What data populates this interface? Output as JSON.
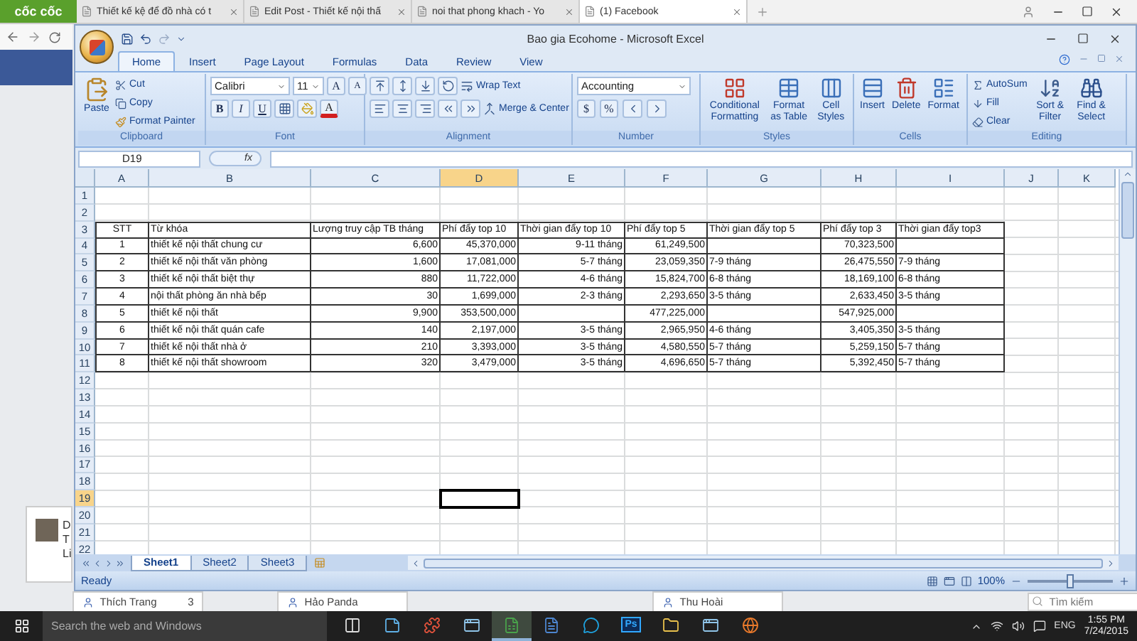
{
  "browser": {
    "logo": "cốc cốc",
    "tabs": [
      {
        "title": "Thiết kế kệ để đồ nhà có t",
        "selected": false
      },
      {
        "title": "Edit Post - Thiết kế nội thấ",
        "selected": false
      },
      {
        "title": "noi that phong khach - Yo",
        "selected": false
      },
      {
        "title": "(1) Facebook",
        "selected": true
      }
    ]
  },
  "page": {
    "notification_lines": [
      "D",
      "T",
      "Li"
    ],
    "chat_tabs": [
      {
        "name": "Thích Trang",
        "count": "3"
      },
      {
        "name": "Hảo Panda"
      },
      {
        "name": "Thu Hoài"
      }
    ],
    "chat_search": {
      "placeholder": "Tìm kiếm"
    }
  },
  "excel": {
    "title": "Bao gia Ecohome - Microsoft Excel",
    "ribbon_tabs": [
      {
        "label": "Home",
        "selected": true
      },
      {
        "label": "Insert",
        "selected": false
      },
      {
        "label": "Page Layout",
        "selected": false
      },
      {
        "label": "Formulas",
        "selected": false
      },
      {
        "label": "Data",
        "selected": false
      },
      {
        "label": "Review",
        "selected": false
      },
      {
        "label": "View",
        "selected": false
      }
    ],
    "clipboard": {
      "label": "Clipboard",
      "paste": "Paste",
      "cut": "Cut",
      "copy": "Copy",
      "format_painter": "Format Painter"
    },
    "font": {
      "label": "Font",
      "name": "Calibri",
      "size": "11",
      "grow": "A",
      "shrink": "A",
      "bold": "B",
      "italic": "I",
      "underline": "U",
      "font_color_button": "A"
    },
    "alignment": {
      "label": "Alignment",
      "wrap": "Wrap Text",
      "merge": "Merge & Center"
    },
    "number": {
      "label": "Number",
      "format": "Accounting",
      "currency": "$",
      "percent": "%"
    },
    "styles": {
      "label": "Styles",
      "buttons": [
        "Conditional Formatting",
        "Format as Table",
        "Cell Styles"
      ]
    },
    "cells": {
      "label": "Cells",
      "buttons": [
        "Insert",
        "Delete",
        "Format"
      ]
    },
    "editing": {
      "label": "Editing",
      "autosum": "AutoSum",
      "fill": "Fill",
      "clear": "Clear",
      "sort": "Sort & Filter",
      "find": "Find & Select"
    },
    "name_box": "D19",
    "fx": "fx",
    "columns": [
      {
        "label": "A",
        "selected": false
      },
      {
        "label": "B",
        "selected": false
      },
      {
        "label": "C",
        "selected": false
      },
      {
        "label": "D",
        "selected": true
      },
      {
        "label": "E",
        "selected": false
      },
      {
        "label": "F",
        "selected": false
      },
      {
        "label": "G",
        "selected": false
      },
      {
        "label": "H",
        "selected": false
      },
      {
        "label": "I",
        "selected": false
      },
      {
        "label": "J",
        "selected": false
      },
      {
        "label": "K",
        "selected": false
      }
    ],
    "rows": [
      {
        "number": "1",
        "selected": false,
        "kind": "blank"
      },
      {
        "number": "2",
        "selected": false,
        "kind": "blank"
      },
      {
        "number": "3",
        "selected": false,
        "kind": "header",
        "cells": [
          "STT",
          "Từ khóa",
          "Lượng truy cập TB tháng",
          "Phí đẩy top 10",
          "Thời gian đẩy top 10",
          "Phí đẩy top 5",
          "Thời gian đẩy top 5",
          "Phí đẩy top 3",
          "Thời gian đẩy top3"
        ]
      },
      {
        "number": "4",
        "selected": false,
        "kind": "data",
        "cells": [
          "1",
          "thiết kế nội thất chung cư",
          "6,600",
          "45,370,000",
          "9-11 tháng",
          "61,249,500",
          null,
          "70,323,500",
          null
        ]
      },
      {
        "number": "5",
        "selected": false,
        "kind": "data",
        "cells": [
          "2",
          "thiết kế nội thất văn phòng",
          "1,600",
          "17,081,000",
          "5-7 tháng",
          "23,059,350",
          "7-9 tháng",
          "26,475,550",
          "7-9 tháng"
        ]
      },
      {
        "number": "6",
        "selected": false,
        "kind": "data",
        "cells": [
          "3",
          "thiết kế nội thất biệt thự",
          "880",
          "11,722,000",
          "4-6 tháng",
          "15,824,700",
          "6-8 tháng",
          "18,169,100",
          "6-8 tháng"
        ]
      },
      {
        "number": "7",
        "selected": false,
        "kind": "data",
        "cells": [
          "4",
          "nội thất phòng ăn nhà bếp",
          "30",
          "1,699,000",
          "2-3 tháng",
          "2,293,650",
          "3-5 tháng",
          "2,633,450",
          "3-5 tháng"
        ]
      },
      {
        "number": "8",
        "selected": false,
        "kind": "data",
        "cells": [
          "5",
          "thiết kế nội thất",
          "9,900",
          "353,500,000",
          null,
          "477,225,000",
          null,
          "547,925,000",
          null
        ]
      },
      {
        "number": "9",
        "selected": false,
        "kind": "data",
        "cells": [
          "6",
          "thiết kế nội thất quán cafe",
          "140",
          "2,197,000",
          "3-5 tháng",
          "2,965,950",
          "4-6 tháng",
          "3,405,350",
          "3-5 tháng"
        ]
      },
      {
        "number": "10",
        "selected": false,
        "kind": "data",
        "cells": [
          "7",
          "thiết kế nội thất nhà ở",
          "210",
          "3,393,000",
          "3-5 tháng",
          "4,580,550",
          "5-7 tháng",
          "5,259,150",
          "5-7 tháng"
        ]
      },
      {
        "number": "11",
        "selected": false,
        "kind": "data",
        "cells": [
          "8",
          "thiết kế nội thất showroom",
          "320",
          "3,479,000",
          "3-5 tháng",
          "4,696,650",
          "5-7 tháng",
          "5,392,450",
          "5-7 tháng"
        ]
      },
      {
        "number": "12",
        "selected": false,
        "kind": "blank"
      },
      {
        "number": "13",
        "selected": false,
        "kind": "blank"
      },
      {
        "number": "14",
        "selected": false,
        "kind": "blank"
      },
      {
        "number": "15",
        "selected": false,
        "kind": "blank"
      },
      {
        "number": "16",
        "selected": false,
        "kind": "blank"
      },
      {
        "number": "17",
        "selected": false,
        "kind": "blank"
      },
      {
        "number": "18",
        "selected": false,
        "kind": "blank"
      },
      {
        "number": "19",
        "selected": true,
        "kind": "blank"
      },
      {
        "number": "20",
        "selected": false,
        "kind": "blank"
      },
      {
        "number": "21",
        "selected": false,
        "kind": "blank"
      },
      {
        "number": "22",
        "selected": false,
        "kind": "blank"
      }
    ],
    "sheets": [
      {
        "label": "Sheet1",
        "selected": true
      },
      {
        "label": "Sheet2",
        "selected": false
      },
      {
        "label": "Sheet3",
        "selected": false
      }
    ],
    "status": "Ready",
    "zoom": {
      "label": "100%",
      "level": 0.5
    }
  },
  "taskbar": {
    "search": {
      "placeholder": "Search the web and Windows"
    },
    "apps": [
      {
        "kind": "taskview",
        "active": false
      },
      {
        "kind": "notes",
        "active": false
      },
      {
        "kind": "puzzle",
        "active": false
      },
      {
        "kind": "window",
        "active": false
      },
      {
        "kind": "sheet",
        "active": true
      },
      {
        "kind": "document",
        "active": false
      },
      {
        "kind": "chat",
        "active": false
      },
      {
        "kind": "photo",
        "active": false,
        "label": "Ps"
      },
      {
        "kind": "folder",
        "active": false
      },
      {
        "kind": "window",
        "active": false
      },
      {
        "kind": "globe",
        "active": false
      }
    ],
    "tray": {
      "language": "ENG",
      "time": "1:55 PM",
      "date": "7/24/2015"
    }
  }
}
